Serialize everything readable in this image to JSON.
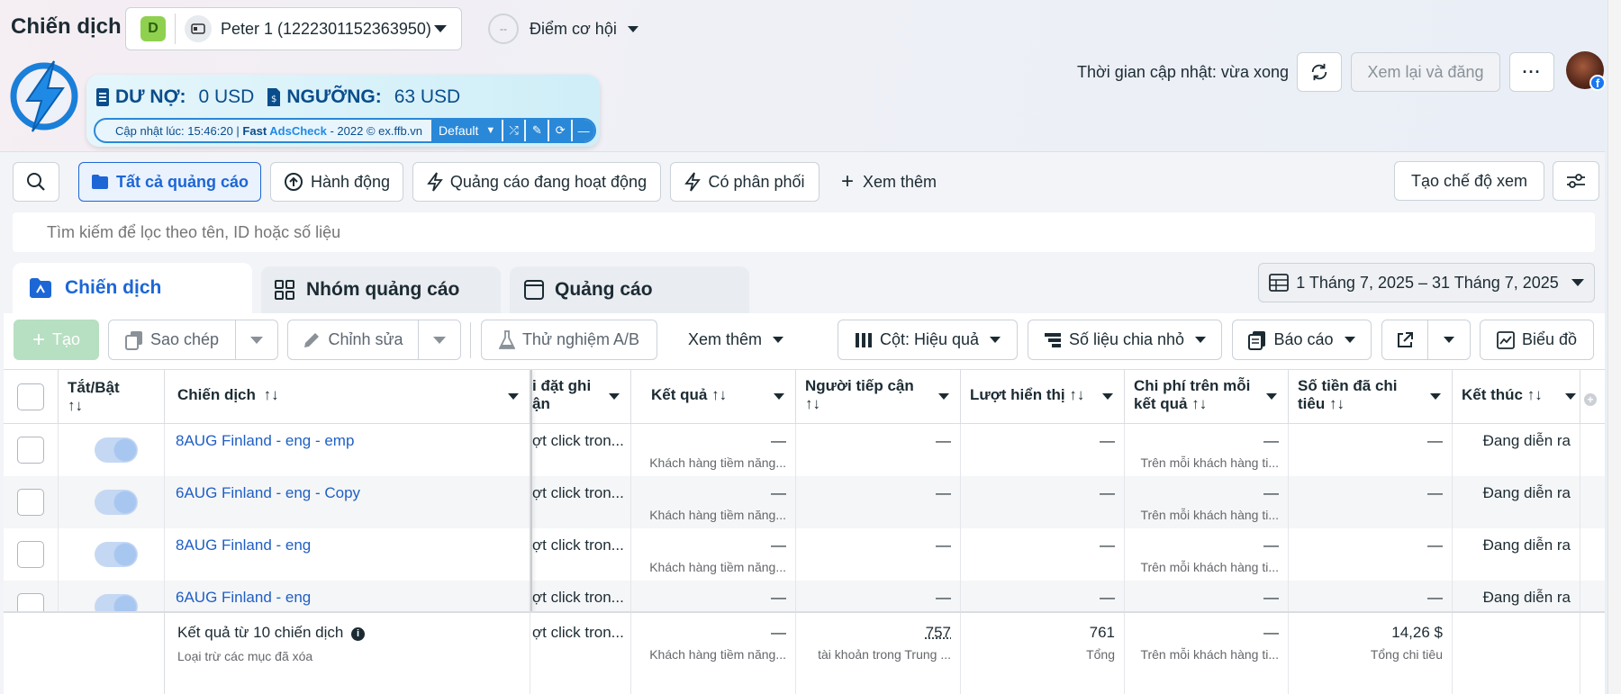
{
  "header": {
    "title": "Chiến dịch",
    "account_badge": "D",
    "account_name": "Peter 1 (1222301152363950)",
    "opportunity_label": "Điểm cơ hội",
    "opportunity_score": "--",
    "update_time": "Thời gian cập nhật: vừa xong",
    "review_publish": "Xem lại và đăng",
    "more": "···"
  },
  "extension": {
    "debt_label": "DƯ NỢ:",
    "debt_value": "0 USD",
    "threshold_label": "NGƯỠNG:",
    "threshold_value": "63 USD",
    "footer_prefix": "Cập nhật lúc: 15:46:20 | ",
    "footer_fast": "Fast ",
    "footer_adscheck": "AdsCheck",
    "footer_suffix": " - 2022 © ex.ffb.vn",
    "dropdown": "Default"
  },
  "filters": {
    "all_ads": "Tất cả quảng cáo",
    "actions": "Hành động",
    "active_ads": "Quảng cáo đang hoạt động",
    "has_delivery": "Có phân phối",
    "see_more": "Xem thêm",
    "create_view": "Tạo chế độ xem",
    "search_placeholder": "Tìm kiếm để lọc theo tên, ID hoặc số liệu"
  },
  "tabs": [
    {
      "label": "Chiến dịch"
    },
    {
      "label": "Nhóm quảng cáo"
    },
    {
      "label": "Quảng cáo"
    }
  ],
  "date_range": "1 Tháng 7, 2025 – 31 Tháng 7, 2025",
  "toolbar": {
    "create": "Tạo",
    "copy": "Sao chép",
    "edit": "Chỉnh sửa",
    "ab_test": "Thử nghiệm A/B",
    "see_more": "Xem thêm",
    "columns": "Cột: Hiệu quả",
    "breakdown": "Số liệu chia nhỏ",
    "reports": "Báo cáo",
    "charts": "Biểu đồ"
  },
  "columns": {
    "toggle": "Tắt/Bật",
    "campaign": "Chiến dịch",
    "attribution_l1": "i đặt ghi",
    "attribution_l2": "ận",
    "results": "Kết quả",
    "reach": "Người tiếp cận",
    "impressions": "Lượt hiển thị",
    "cost_l1": "Chi phí trên mỗi",
    "cost_l2": "kết quả",
    "spent_l1": "Số tiền đã chi",
    "spent_l2": "tiêu",
    "ends": "Kết thúc",
    "sort": "↑↓"
  },
  "rows": [
    {
      "name": "8AUG Finland - eng - emp",
      "attribution": "ợt click tron...",
      "results": "—",
      "results_sub": "Khách hàng tiềm năng...",
      "reach": "—",
      "impressions": "—",
      "cost": "—",
      "cost_sub": "Trên mỗi khách hàng ti...",
      "spent": "—",
      "ends": "Đang diễn ra"
    },
    {
      "name": "6AUG Finland - eng - Copy",
      "attribution": "ợt click tron...",
      "results": "—",
      "results_sub": "Khách hàng tiềm năng...",
      "reach": "—",
      "impressions": "—",
      "cost": "—",
      "cost_sub": "Trên mỗi khách hàng ti...",
      "spent": "—",
      "ends": "Đang diễn ra"
    },
    {
      "name": "8AUG Finland - eng",
      "attribution": "ợt click tron...",
      "results": "—",
      "results_sub": "Khách hàng tiềm năng...",
      "reach": "—",
      "impressions": "—",
      "cost": "—",
      "cost_sub": "Trên mỗi khách hàng ti...",
      "spent": "—",
      "ends": "Đang diễn ra"
    },
    {
      "name": "6AUG Finland - eng",
      "attribution": "ợt click tron...",
      "results": "—",
      "results_sub": "",
      "reach": "—",
      "impressions": "—",
      "cost": "—",
      "cost_sub": "",
      "spent": "—",
      "ends": "Đang diễn ra"
    }
  ],
  "summary": {
    "label": "Kết quả từ 10 chiến dịch",
    "sub": "Loại trừ các mục đã xóa",
    "attribution": "ợt click tron...",
    "results": "—",
    "results_sub": "Khách hàng tiềm năng...",
    "reach": "757",
    "reach_sub": "tài khoản trong Trung ...",
    "impressions": "761",
    "impressions_sub": "Tổng",
    "cost": "—",
    "cost_sub": "Trên mỗi khách hàng ti...",
    "spent": "14,26 $",
    "spent_sub": "Tổng chi tiêu"
  },
  "colors": {
    "accent": "#1877f2",
    "link": "#1f5fc5",
    "extension_text": "#0a4d8c",
    "extension_bar": "#2a88d8",
    "create_button": "#b7dfc1"
  }
}
